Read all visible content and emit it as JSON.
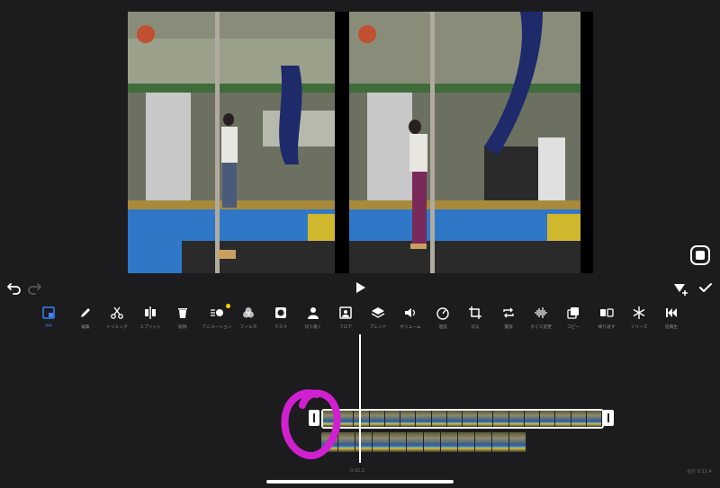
{
  "controls": {
    "undo_icon": "undo-icon",
    "redo_icon": "redo-icon",
    "play_icon": "play-icon",
    "keyframe_icon": "keyframe-add-icon",
    "done_icon": "checkmark-icon",
    "fullscreen_icon": "fullscreen-icon"
  },
  "toolbar": {
    "tools": [
      {
        "id": "pip",
        "label": "PIP",
        "icon": "pip-icon",
        "active": true
      },
      {
        "id": "edit",
        "label": "編集",
        "icon": "pencil-icon"
      },
      {
        "id": "trim",
        "label": "トリミング",
        "icon": "scissors-icon"
      },
      {
        "id": "split",
        "label": "スプリット",
        "icon": "split-icon"
      },
      {
        "id": "delete",
        "label": "削除",
        "icon": "trash-icon"
      },
      {
        "id": "animation",
        "label": "アニメーション",
        "icon": "animation-icon"
      },
      {
        "id": "filter",
        "label": "フィルタ",
        "icon": "filter-icon"
      },
      {
        "id": "mask",
        "label": "マスク",
        "icon": "mask-icon"
      },
      {
        "id": "cutout",
        "label": "切り抜く",
        "icon": "cutout-icon"
      },
      {
        "id": "frame",
        "label": "フロア",
        "icon": "frame-icon"
      },
      {
        "id": "blend",
        "label": "ブレンド",
        "icon": "layers-icon"
      },
      {
        "id": "volume",
        "label": "ボリューム",
        "icon": "speaker-icon"
      },
      {
        "id": "speed",
        "label": "速度",
        "icon": "speedometer-icon"
      },
      {
        "id": "crop",
        "label": "切る",
        "icon": "crop-icon"
      },
      {
        "id": "replace",
        "label": "置換",
        "icon": "replace-icon"
      },
      {
        "id": "voice",
        "label": "ボイス変更",
        "icon": "waveform-icon"
      },
      {
        "id": "copy",
        "label": "コピー",
        "icon": "copy-icon"
      },
      {
        "id": "repeat",
        "label": "繰り返す",
        "icon": "repeat-icon"
      },
      {
        "id": "freeze",
        "label": "フリーズ",
        "icon": "snowflake-icon"
      },
      {
        "id": "reverse",
        "label": "逆再生",
        "icon": "reverse-icon"
      }
    ]
  },
  "timeline": {
    "current_time": "0:02.2",
    "total_time": "合計 0:11.4"
  },
  "colors": {
    "background": "#1c1c1e",
    "active": "#3b82f6",
    "annotation": "#d020d0",
    "dot": "#f5d20b"
  }
}
